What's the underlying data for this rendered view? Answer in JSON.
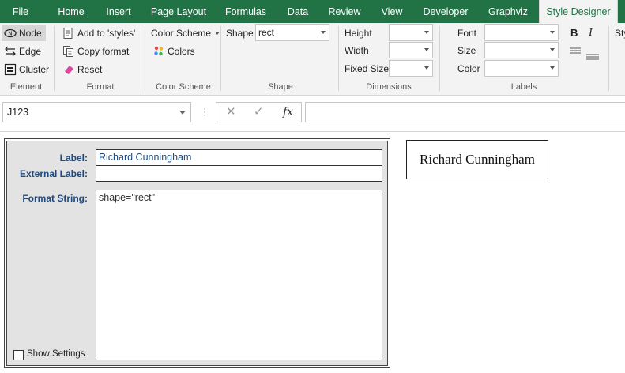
{
  "tabs": [
    {
      "label": "File"
    },
    {
      "label": "Home"
    },
    {
      "label": "Insert"
    },
    {
      "label": "Page Layout"
    },
    {
      "label": "Formulas"
    },
    {
      "label": "Data"
    },
    {
      "label": "Review"
    },
    {
      "label": "View"
    },
    {
      "label": "Developer"
    },
    {
      "label": "Graphviz"
    },
    {
      "label": "Style Designer"
    }
  ],
  "active_tab": "Style Designer",
  "ribbon": {
    "element": {
      "group_label": "Element",
      "node": "Node",
      "edge": "Edge",
      "cluster": "Cluster",
      "selected": "Node"
    },
    "format": {
      "group_label": "Format",
      "add_to_styles": "Add to 'styles'",
      "copy_format": "Copy format",
      "reset": "Reset"
    },
    "color_scheme": {
      "group_label": "Color Scheme",
      "scheme_dropdown": "Color Scheme",
      "colors": "Colors"
    },
    "shape": {
      "group_label": "Shape",
      "label": "Shape",
      "value": "rect"
    },
    "dimensions": {
      "group_label": "Dimensions",
      "height_label": "Height",
      "width_label": "Width",
      "fixed_size_label": "Fixed Size",
      "height_value": "",
      "width_value": "",
      "fixed_size_value": ""
    },
    "labels": {
      "group_label": "Labels",
      "font_label": "Font",
      "size_label": "Size",
      "color_label": "Color",
      "font_value": "",
      "size_value": "",
      "color_value": "",
      "bold": "B",
      "italic": "I"
    },
    "partial_tab": "Sty"
  },
  "formula_bar": {
    "name_box": "J123",
    "cancel_icon": "✕",
    "enter_icon": "✓",
    "fx_icon": "fx",
    "formula": ""
  },
  "panel": {
    "label_caption": "Label:",
    "label_value": "Richard Cunningham",
    "external_label_caption": "External Label:",
    "external_label_value": "",
    "format_string_caption": "Format String:",
    "format_string_value": "shape=\"rect\"",
    "show_settings": "Show Settings",
    "show_settings_checked": false
  },
  "preview": {
    "node_label": "Richard Cunningham"
  },
  "colors": {
    "ribbon_green": "#217346",
    "label_blue": "#1f497d"
  }
}
